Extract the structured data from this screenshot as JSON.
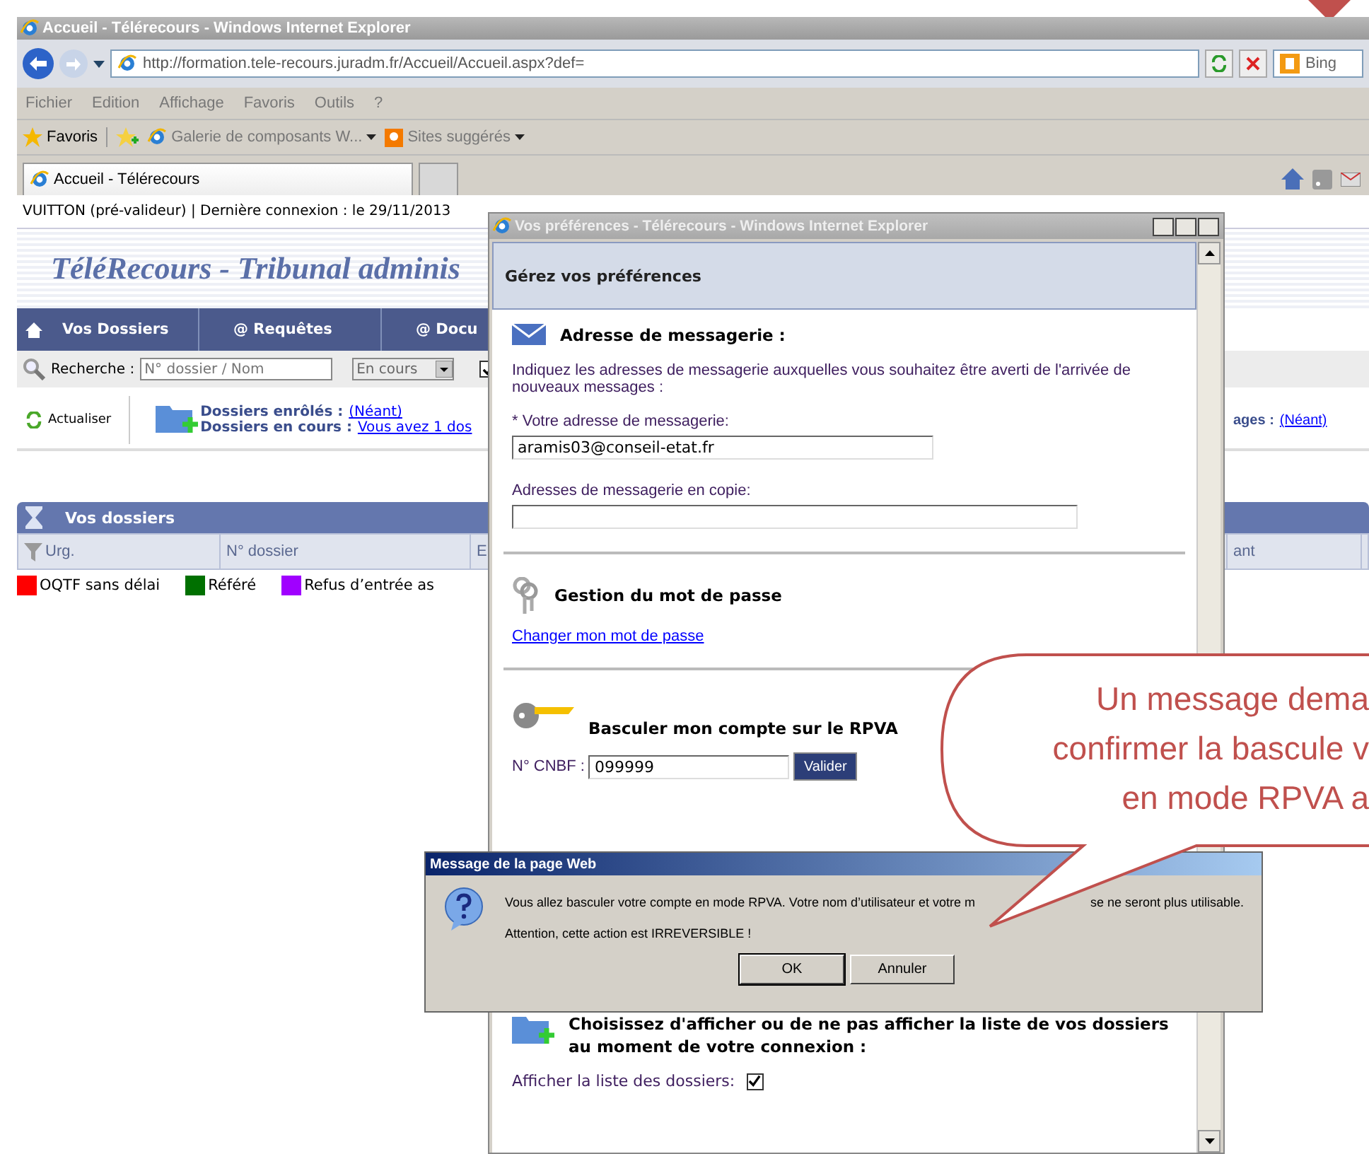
{
  "browser": {
    "title": "Accueil - Télérecours - Windows Internet Explorer",
    "address": "http://formation.tele-recours.juradm.fr/Accueil/Accueil.aspx?def=",
    "search_placeholder": "Bing",
    "menu": [
      "Fichier",
      "Edition",
      "Affichage",
      "Favoris",
      "Outils",
      "?"
    ],
    "favorites": {
      "label": "Favoris",
      "items": [
        {
          "label": "Galerie de composants W...",
          "kind": "page"
        },
        {
          "label": "Sites suggérés",
          "kind": "suggest"
        }
      ]
    },
    "tabs": [
      {
        "label": "Accueil - Télérecours",
        "selected": true
      }
    ]
  },
  "page": {
    "user_line": "VUITTON (pré-valideur) | Dernière connexion : le 29/11/2013",
    "banner": "TéléRecours - Tribunal adminis",
    "nav": [
      {
        "label": "Vos Dossiers",
        "kind": "home"
      },
      {
        "label": "@ Requêtes",
        "kind": "plain"
      },
      {
        "label": "@ Docu",
        "kind": "plain"
      }
    ],
    "search": {
      "label": "Recherche :",
      "placeholder": "N° dossier / Nom",
      "status": "En cours",
      "checked": true
    },
    "refresh": "Actualiser",
    "enrolled": {
      "label": "Dossiers enrôlés :",
      "link": "(Néant)"
    },
    "in_progress": {
      "label": "Dossiers en cours :",
      "link": "Vous avez 1 dos"
    },
    "messages": {
      "label": "ages :",
      "link": "(Néant)"
    },
    "panel_title": "Vos dossiers",
    "columns": [
      "Urg.",
      "N° dossier",
      "E",
      "ant"
    ],
    "legend": [
      {
        "label": "OQTF sans délai",
        "color": "#ff0000"
      },
      {
        "label": "Référé",
        "color": "#007000"
      },
      {
        "label": "Refus d’entrée as",
        "color": "#a000ff"
      }
    ]
  },
  "popup": {
    "title": "Vos préférences - Télérecours - Windows Internet Explorer",
    "heading": "Gérez vos préférences",
    "email": {
      "title": "Adresse de messagerie :",
      "description": "Indiquez les adresses de messagerie auxquelles vous souhaitez être averti de l'arrivée de nouveaux messages :",
      "address_label": "* Votre adresse de messagerie:",
      "address_value": "aramis03@conseil-etat.fr",
      "copy_label": "Adresses de messagerie en copie:"
    },
    "password": {
      "title": "Gestion du mot de passe",
      "link": "Changer mon mot de passe"
    },
    "rpva": {
      "title": "Basculer mon compte sur le RPVA",
      "label": "N° CNBF :",
      "value": "099999",
      "button": "Valider"
    },
    "display": {
      "title": "Choisissez d'afficher ou de ne pas afficher la liste de vos dossiers au moment de votre connexion :",
      "label": "Afficher la liste des dossiers:",
      "checked": true
    }
  },
  "dialog": {
    "title": "Message de la page Web",
    "message_start": "Vous allez basculer votre compte en mode RPVA. Votre nom d’utilisateur et votre m",
    "message_end": "se ne seront plus utilisable.",
    "warning": "Attention, cette action est IRREVERSIBLE !",
    "buttons": [
      "OK",
      "Annuler"
    ]
  },
  "callout": {
    "lines": [
      "Un message dema",
      "confirmer la bascule v",
      "en mode RPVA a"
    ]
  }
}
